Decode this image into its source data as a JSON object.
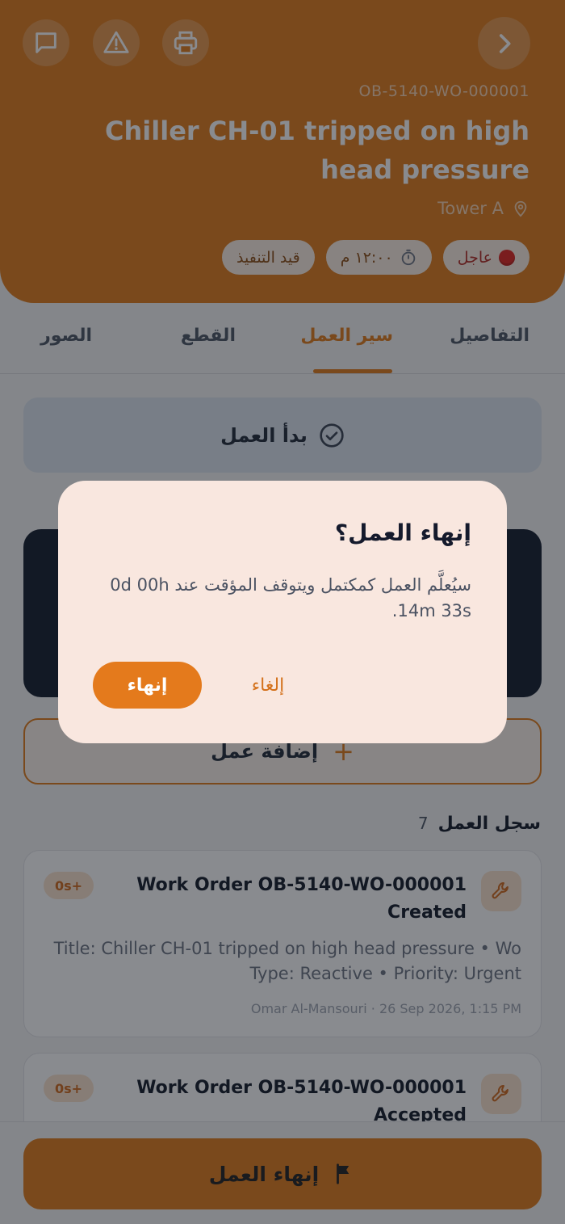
{
  "header": {
    "code": "OB-5140-WO-000001",
    "title": "Chiller CH-01 tripped on high head pressure",
    "location": "Tower A",
    "chips": {
      "priority": "عاجل",
      "time": "١٢:٠٠ م",
      "status": "قيد التنفيذ"
    },
    "icons": [
      "chat-icon",
      "warning-icon",
      "print-icon",
      "chevron-right-icon"
    ]
  },
  "tabs": {
    "details": "التفاصيل",
    "workflow": "سير العمل",
    "parts": "القطع",
    "photos": "الصور"
  },
  "workflow": {
    "started_label": "بدأ العمل",
    "add_work_label": "إضافة عمل",
    "add_symbol": "+",
    "log_title": "سجل العمل",
    "log_count": "7"
  },
  "log": [
    {
      "title": "Work Order OB-5140-WO-000001 Created",
      "badge": "0s+",
      "description": "Title: Chiller CH-01 tripped on high head pressure • Wo Type: Reactive • Priority: Urgent",
      "meta": "Omar Al-Mansouri · 26 Sep 2026, 1:15 PM"
    },
    {
      "title": "Work Order OB-5140-WO-000001 Accepted",
      "badge": "0s+"
    }
  ],
  "bottom": {
    "finish_label": "إنهاء العمل"
  },
  "dialog": {
    "title": "إنهاء العمل؟",
    "message": "سيُعلَّم العمل كمكتمل ويتوقف المؤقت عند 0d 00h 14m 33s.",
    "confirm_label": "إنهاء",
    "cancel_label": "إلغاء"
  },
  "colors": {
    "accent": "#e07a18",
    "dark_panel": "#111a2b",
    "dialog_bg": "#f9e7df",
    "urgent": "#e0231c"
  }
}
